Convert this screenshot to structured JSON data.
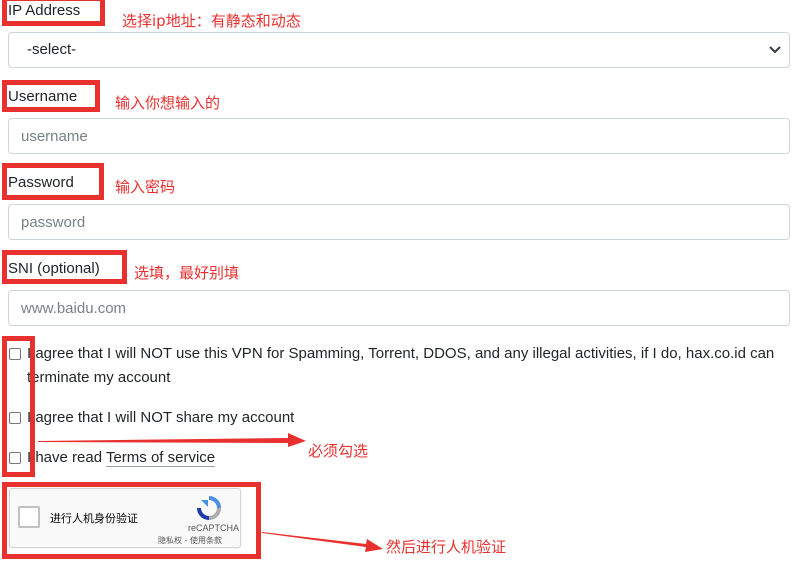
{
  "form": {
    "ip": {
      "label": "IP Address",
      "selected": "-select-"
    },
    "username": {
      "label": "Username",
      "placeholder": "username"
    },
    "password": {
      "label": "Password",
      "placeholder": "password"
    },
    "sni": {
      "label": "SNI (optional)",
      "placeholder": "www.baidu.com"
    },
    "agreements": [
      {
        "text": "I agree that I will NOT use this VPN for Spamming, Torrent, DDOS, and any illegal activities, if I do, hax.co.id can terminate my account"
      },
      {
        "text": "I agree that I will NOT share my account"
      },
      {
        "text_before": "I have read ",
        "link": "Terms of service"
      }
    ],
    "captcha": {
      "text": "进行人机身份验证",
      "brand": "reCAPTCHA",
      "links": "隐私权 - 使用条款"
    }
  },
  "annotations": {
    "ip": "选择ip地址：有静态和动态",
    "username": "输入你想输入的",
    "password": "输入密码",
    "sni": "选填，最好别填",
    "checkboxes": "必须勾选",
    "captcha": "然后进行人机验证"
  },
  "colors": {
    "annotation": "#e8312f",
    "border": "#ced4da",
    "text": "#212529"
  },
  "icons": {
    "select": "chevron-down-icon",
    "captcha": "recaptcha-logo-icon",
    "arrow": "red-arrow-icon"
  }
}
